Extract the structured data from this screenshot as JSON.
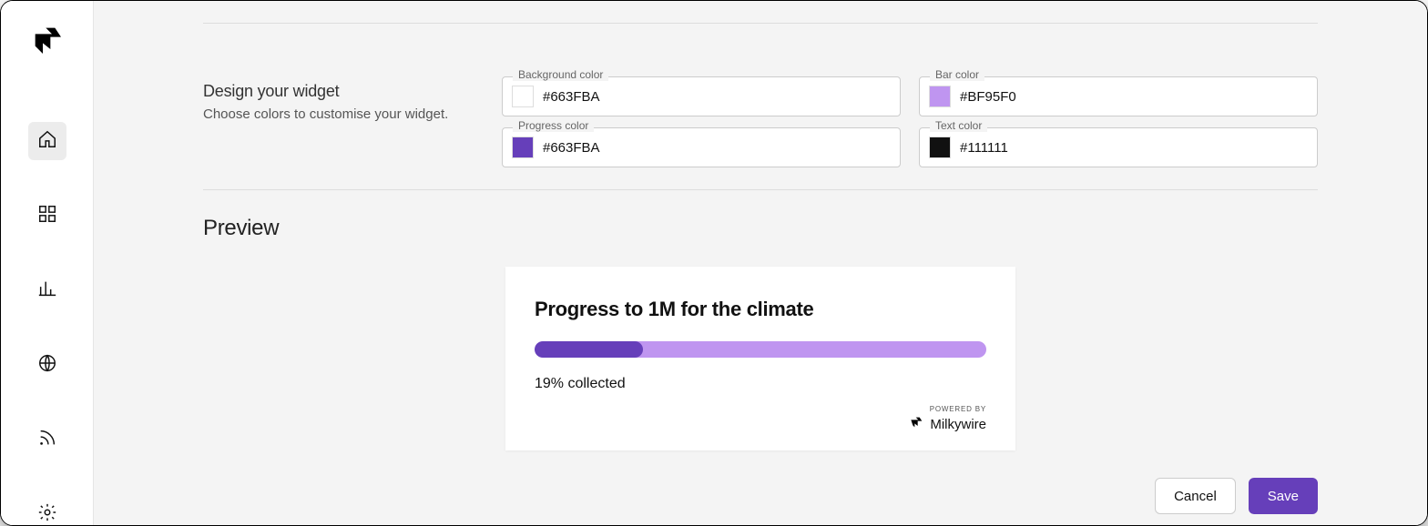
{
  "design": {
    "title": "Design your widget",
    "subtitle": "Choose colors to customise your widget.",
    "fields": {
      "background": {
        "label": "Background color",
        "value": "#663FBA",
        "swatch": "#FFFFFF"
      },
      "bar": {
        "label": "Bar color",
        "value": "#BF95F0",
        "swatch": "#BF95F0"
      },
      "progress": {
        "label": "Progress color",
        "value": "#663FBA",
        "swatch": "#663FBA"
      },
      "text": {
        "label": "Text color",
        "value": "#111111",
        "swatch": "#111111"
      }
    }
  },
  "preview": {
    "heading": "Preview",
    "widget_title": "Progress to 1M for the climate",
    "progress_pct": 24,
    "collected_text": "19% collected",
    "powered_by_label": "POWERED BY",
    "powered_by_brand": "Milkywire",
    "colors": {
      "bar": "#BF95F0",
      "progress": "#663FBA",
      "text": "#111111",
      "bg": "#FFFFFF"
    }
  },
  "actions": {
    "cancel": "Cancel",
    "save": "Save"
  },
  "sidebar": {
    "items": [
      "home",
      "apps",
      "analytics",
      "globe",
      "rss",
      "settings"
    ],
    "active": "home"
  }
}
